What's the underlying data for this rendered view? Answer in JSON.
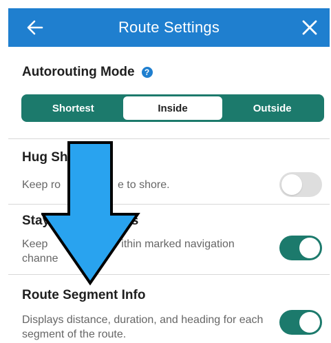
{
  "header": {
    "title": "Route Settings",
    "back_icon": "arrow-left-icon",
    "close_icon": "close-icon",
    "background_color": "#1f7fcf"
  },
  "autorouting": {
    "title": "Autorouting Mode",
    "help_icon_glyph": "?",
    "options": [
      "Shortest",
      "Inside",
      "Outside"
    ],
    "selected": "Inside",
    "accent_color": "#1c7a6c"
  },
  "settings": [
    {
      "title": "Hug Sh",
      "desc_line1": "Keep ro",
      "desc_fragment": "e to shore.",
      "enabled": false
    },
    {
      "title": "Stay in",
      "title_fragment": "els",
      "desc_line1": "Keep",
      "desc_fragment": "ithin marked navigation",
      "desc_line2": "channe",
      "enabled": true
    },
    {
      "title": "Route Segment Info",
      "description": "Displays distance, duration, and heading for each segment of the route.",
      "enabled": true
    }
  ],
  "overlay": {
    "icon": "down-arrow-annotation",
    "color": "#29a3ef"
  }
}
